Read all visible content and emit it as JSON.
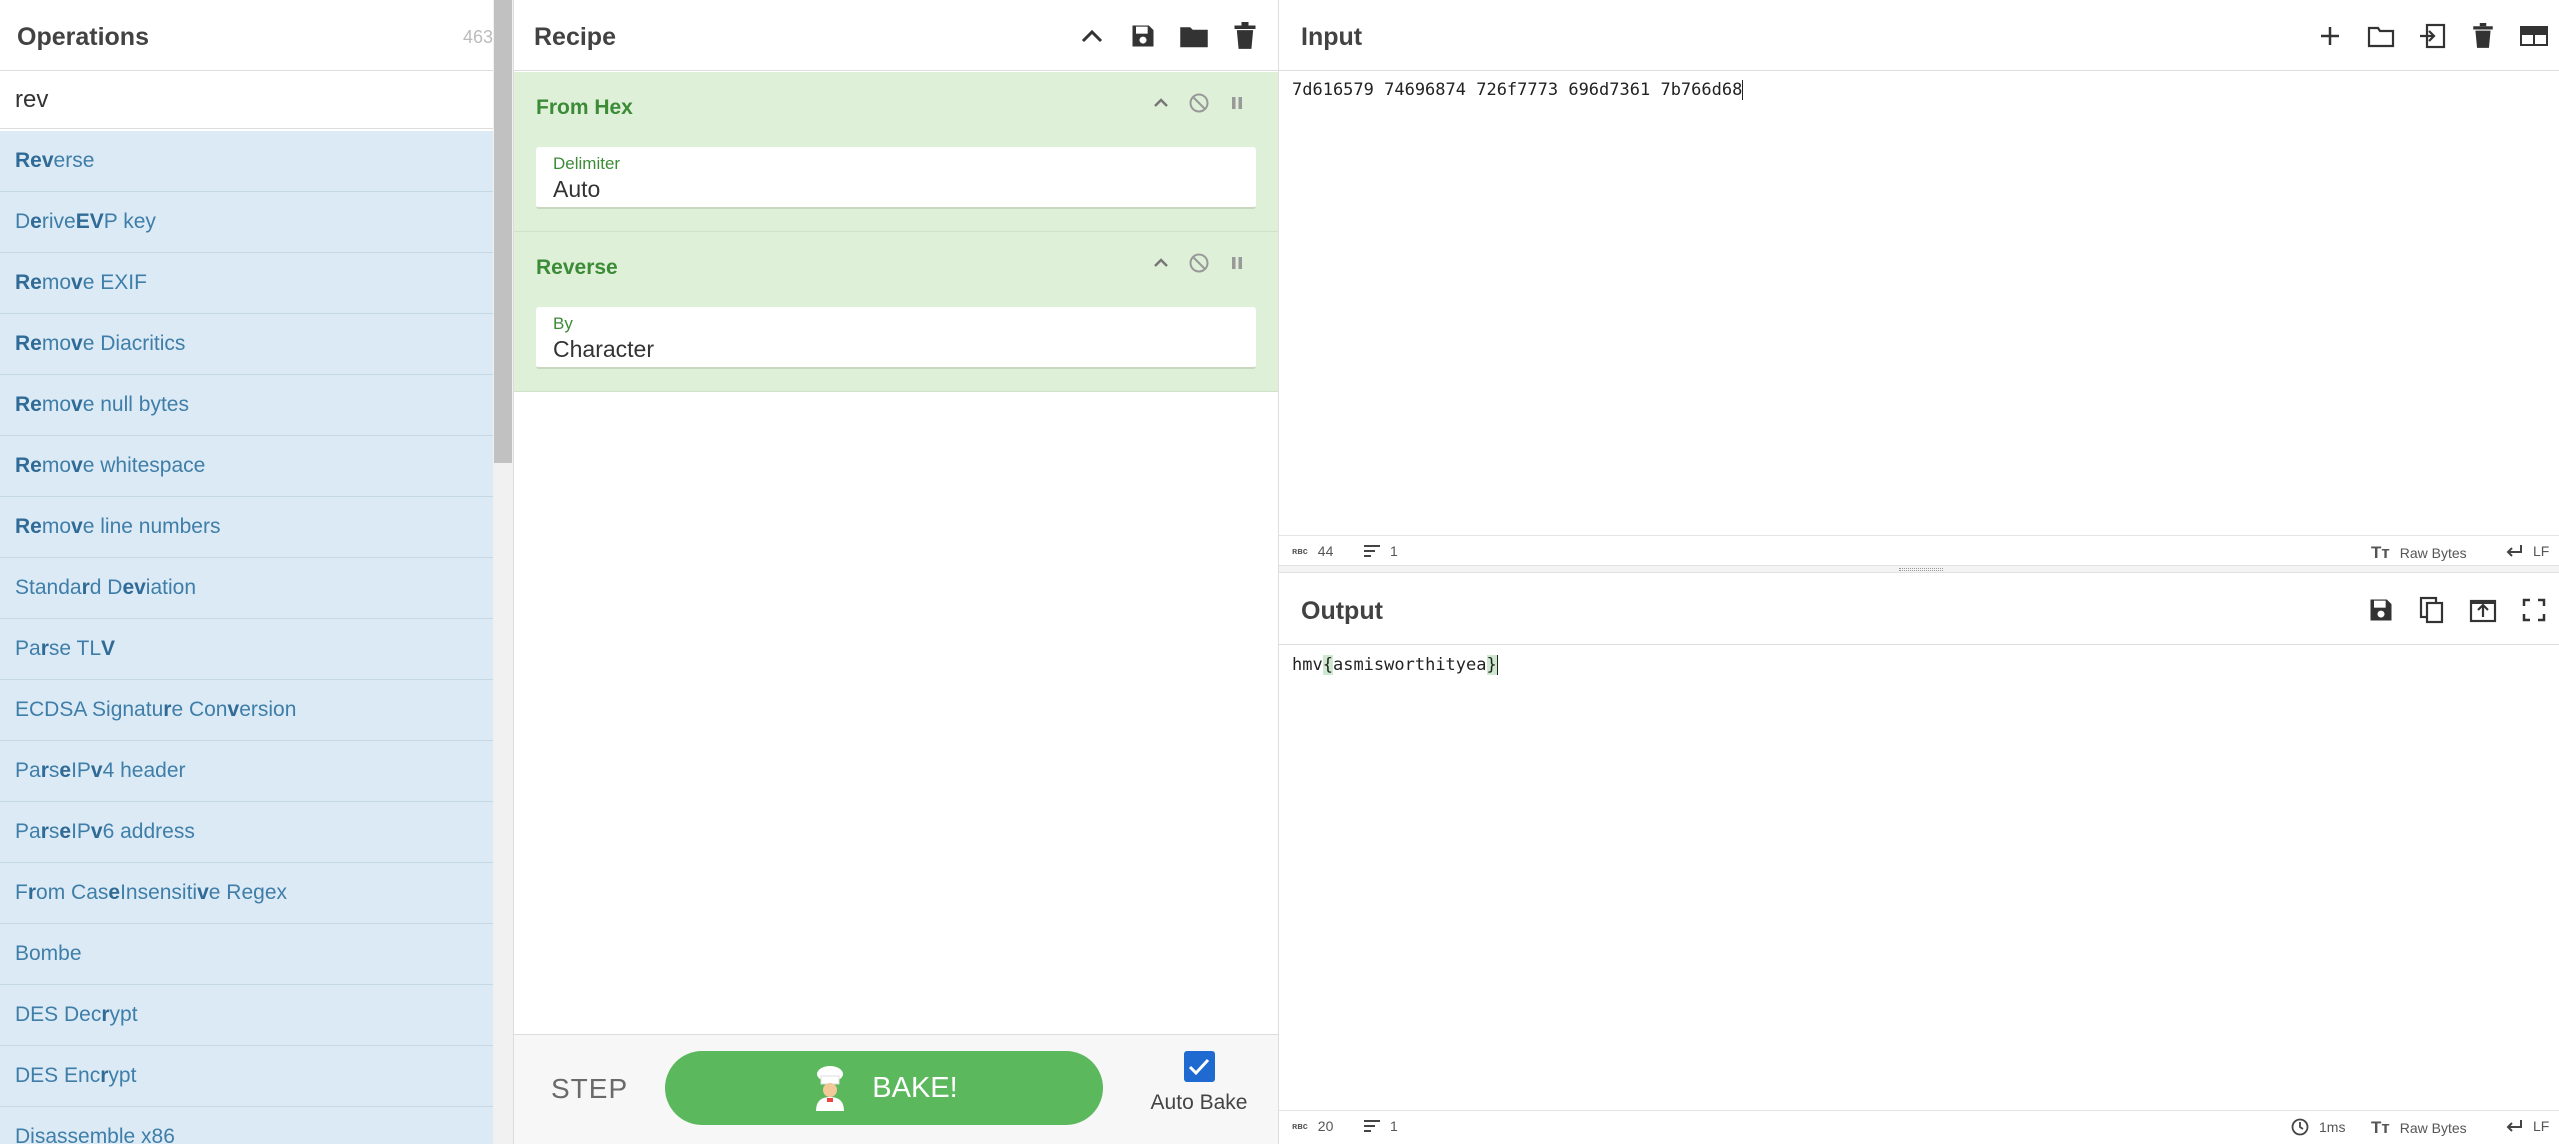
{
  "operations": {
    "title": "Operations",
    "count": "463",
    "search_value": "rev",
    "items": [
      {
        "segments": [
          {
            "t": "Rev",
            "b": true
          },
          {
            "t": "erse",
            "b": false
          }
        ]
      },
      {
        "segments": [
          {
            "t": "D",
            "b": false
          },
          {
            "t": "e",
            "b": true
          },
          {
            "t": "ri",
            "b": false
          },
          {
            "t": "v",
            "b": false
          },
          {
            "t": "e ",
            "b": false
          },
          {
            "t": "EV",
            "b": true
          },
          {
            "t": "P key",
            "b": false
          }
        ]
      },
      {
        "segments": [
          {
            "t": "Re",
            "b": true
          },
          {
            "t": "mo",
            "b": false
          },
          {
            "t": "v",
            "b": true
          },
          {
            "t": "e EXIF",
            "b": false
          }
        ]
      },
      {
        "segments": [
          {
            "t": "Re",
            "b": true
          },
          {
            "t": "mo",
            "b": false
          },
          {
            "t": "v",
            "b": true
          },
          {
            "t": "e Diacritics",
            "b": false
          }
        ]
      },
      {
        "segments": [
          {
            "t": "Re",
            "b": true
          },
          {
            "t": "mo",
            "b": false
          },
          {
            "t": "v",
            "b": true
          },
          {
            "t": "e null bytes",
            "b": false
          }
        ]
      },
      {
        "segments": [
          {
            "t": "Re",
            "b": true
          },
          {
            "t": "mo",
            "b": false
          },
          {
            "t": "v",
            "b": true
          },
          {
            "t": "e whitespace",
            "b": false
          }
        ]
      },
      {
        "segments": [
          {
            "t": "Re",
            "b": true
          },
          {
            "t": "mo",
            "b": false
          },
          {
            "t": "v",
            "b": true
          },
          {
            "t": "e line numbers",
            "b": false
          }
        ]
      },
      {
        "segments": [
          {
            "t": "Standa",
            "b": false
          },
          {
            "t": "r",
            "b": true
          },
          {
            "t": "d D",
            "b": false
          },
          {
            "t": "ev",
            "b": true
          },
          {
            "t": "iation",
            "b": false
          }
        ]
      },
      {
        "segments": [
          {
            "t": "Pa",
            "b": false
          },
          {
            "t": "r",
            "b": true
          },
          {
            "t": "se TL",
            "b": false
          },
          {
            "t": "V",
            "b": true
          }
        ]
      },
      {
        "segments": [
          {
            "t": "ECDSA Signatu",
            "b": false
          },
          {
            "t": "r",
            "b": true
          },
          {
            "t": "e Con",
            "b": false
          },
          {
            "t": "v",
            "b": true
          },
          {
            "t": "ersion",
            "b": false
          }
        ]
      },
      {
        "segments": [
          {
            "t": "Pa",
            "b": false
          },
          {
            "t": "r",
            "b": true
          },
          {
            "t": "s",
            "b": false
          },
          {
            "t": "e",
            "b": true
          },
          {
            "t": " IP",
            "b": false
          },
          {
            "t": "v",
            "b": true
          },
          {
            "t": "4 header",
            "b": false
          }
        ]
      },
      {
        "segments": [
          {
            "t": "Pa",
            "b": false
          },
          {
            "t": "r",
            "b": true
          },
          {
            "t": "s",
            "b": false
          },
          {
            "t": "e",
            "b": true
          },
          {
            "t": " IP",
            "b": false
          },
          {
            "t": "v",
            "b": true
          },
          {
            "t": "6 address",
            "b": false
          }
        ]
      },
      {
        "segments": [
          {
            "t": "F",
            "b": false
          },
          {
            "t": "r",
            "b": true
          },
          {
            "t": "om Cas",
            "b": false
          },
          {
            "t": "e",
            "b": true
          },
          {
            "t": " Insensiti",
            "b": false
          },
          {
            "t": "v",
            "b": true
          },
          {
            "t": "e Regex",
            "b": false
          }
        ]
      },
      {
        "segments": [
          {
            "t": "Bombe",
            "b": false
          }
        ]
      },
      {
        "segments": [
          {
            "t": "DES Dec",
            "b": false
          },
          {
            "t": "r",
            "b": true
          },
          {
            "t": "ypt",
            "b": false
          }
        ]
      },
      {
        "segments": [
          {
            "t": "DES Enc",
            "b": false
          },
          {
            "t": "r",
            "b": true
          },
          {
            "t": "ypt",
            "b": false
          }
        ]
      },
      {
        "segments": [
          {
            "t": "Disassemble x86",
            "b": false
          }
        ]
      }
    ]
  },
  "recipe": {
    "title": "Recipe",
    "ops": [
      {
        "name": "From Hex",
        "arg_label": "Delimiter",
        "arg_value": "Auto"
      },
      {
        "name": "Reverse",
        "arg_label": "By",
        "arg_value": "Character"
      }
    ],
    "step_label": "STEP",
    "bake_label": "BAKE!",
    "auto_bake_label": "Auto Bake",
    "auto_bake_checked": true
  },
  "input": {
    "title": "Input",
    "text": "7d616579 74696874 726f7773 696d7361 7b766d68",
    "status": {
      "chars": "44",
      "lines": "1",
      "encoding": "Raw Bytes",
      "eol": "LF"
    }
  },
  "output": {
    "title": "Output",
    "text_prefix": "hmv",
    "text_open": "{",
    "text_middle": "asmisworthityea",
    "text_close": "}",
    "status": {
      "chars": "20",
      "lines": "1",
      "time": "1ms",
      "encoding": "Raw Bytes",
      "eol": "LF"
    }
  },
  "colors": {
    "ops_bg": "#dbeaf5",
    "recipe_card_bg": "#dff0d8",
    "bake_green": "#5cb85c",
    "checkbox_blue": "#1f6ad1"
  },
  "icons": [
    "chevron-up-icon",
    "save-icon",
    "folder-icon",
    "trash-icon",
    "plus-icon",
    "input-arrow-icon",
    "layout-icon",
    "copy-icon",
    "open-in-input-icon",
    "maximise-icon",
    "disable-icon",
    "pause-icon",
    "chef-icon",
    "clock-icon",
    "font-icon",
    "return-icon",
    "lines-icon"
  ]
}
